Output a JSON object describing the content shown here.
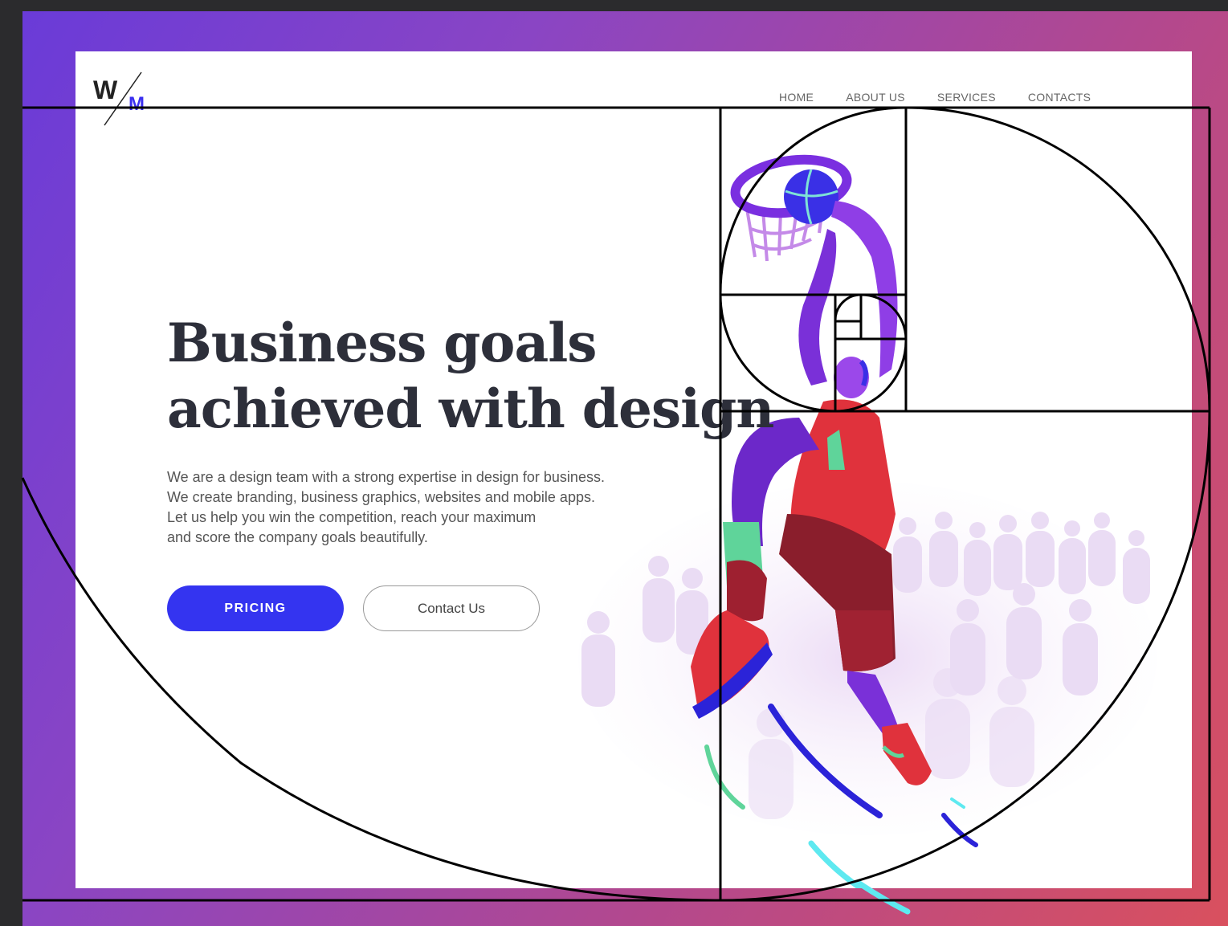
{
  "logo": {
    "top": "W",
    "bottom": "M"
  },
  "nav": {
    "items": [
      "HOME",
      "ABOUT US",
      "SERVICES",
      "CONTACTS"
    ]
  },
  "hero": {
    "headline_line1": "Business goals",
    "headline_line2": "achieved with design",
    "description": [
      "We are a design team with a strong expertise in design for business.",
      "We create branding, business graphics, websites and mobile apps.",
      "Let us help you win the competition, reach your maximum",
      "and score the company goals beautifully."
    ],
    "primary_button": "PRICING",
    "secondary_button": "Contact Us"
  },
  "colors": {
    "accent": "#3434f0",
    "headline": "#2d2f3a",
    "jersey": "#e0323c",
    "skin": "#8f3ee6"
  },
  "illustration": "basketball-player-dunking"
}
